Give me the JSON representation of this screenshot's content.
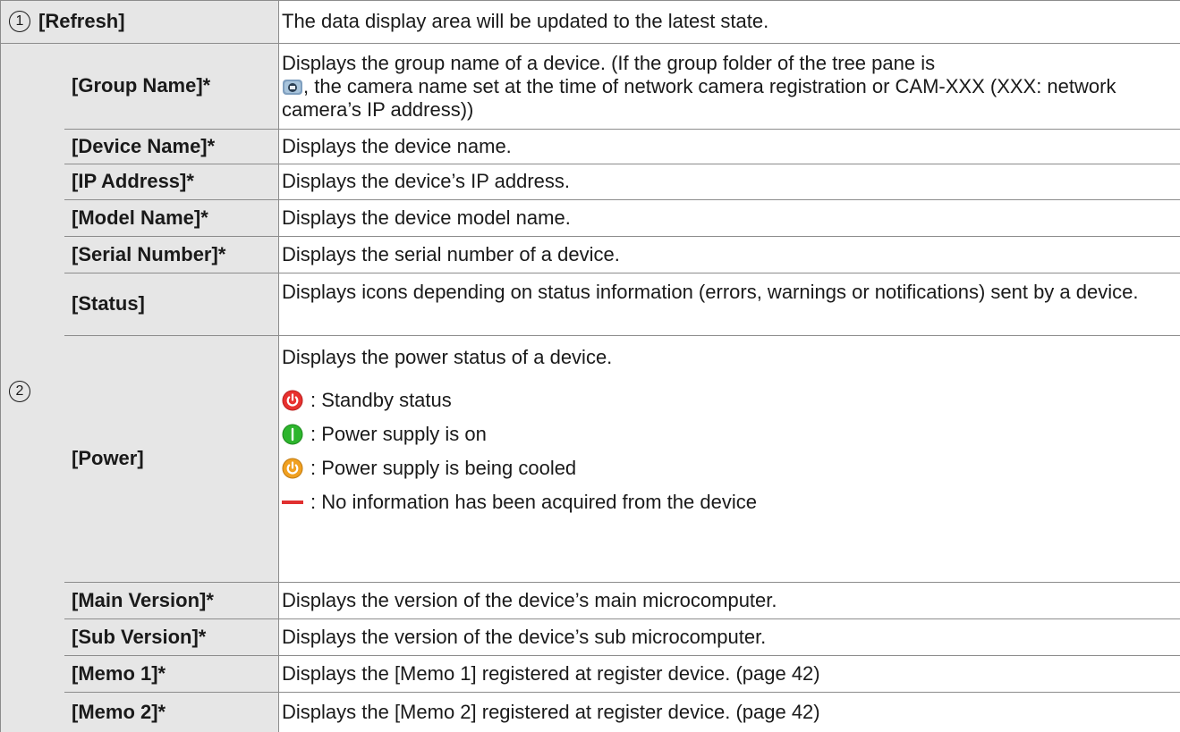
{
  "rows": {
    "refresh": {
      "number": "1",
      "label": "[Refresh]",
      "desc": "The data display area will be updated to the latest state."
    },
    "group_number": "2",
    "group_name": {
      "label": "[Group Name]*",
      "desc_before_icon": "Displays the group name of a device. (If the group folder of the tree pane is",
      "desc_after_icon": ", the camera name set at the time of network camera registration or CAM-XXX (XXX: network camera’s IP address))"
    },
    "device_name": {
      "label": "[Device Name]*",
      "desc": "Displays the device name."
    },
    "ip_address": {
      "label": "[IP Address]*",
      "desc": "Displays the device’s IP address."
    },
    "model_name": {
      "label": "[Model Name]*",
      "desc": "Displays the device model name."
    },
    "serial_number": {
      "label": "[Serial Number]*",
      "desc": "Displays the serial number of a device."
    },
    "status": {
      "label": "[Status]",
      "desc": "Displays icons depending on status information (errors, warnings or notifications) sent by a device."
    },
    "power": {
      "label": "[Power]",
      "desc": "Displays the power status of a device.",
      "items": [
        {
          "icon": "standby-power-icon",
          "color": "#e8312f",
          "text": ": Standby status"
        },
        {
          "icon": "power-on-icon",
          "color": "#2db52d",
          "text": ": Power supply is on"
        },
        {
          "icon": "cooling-power-icon",
          "color": "#f0a020",
          "text": ": Power supply is being cooled"
        },
        {
          "icon": "no-info-dash-icon",
          "color": "#e03030",
          "text": ": No information has been acquired from the device"
        }
      ]
    },
    "main_version": {
      "label": "[Main Version]*",
      "desc": "Displays the version of the device’s main microcomputer."
    },
    "sub_version": {
      "label": "[Sub Version]*",
      "desc": "Displays the version of the device’s sub microcomputer."
    },
    "memo1": {
      "label": "[Memo 1]*",
      "desc": "Displays the [Memo 1] registered at register device. (page 42)"
    },
    "memo2": {
      "label": "[Memo 2]*",
      "desc": "Displays the [Memo 2] registered at register device. (page 42)"
    }
  }
}
